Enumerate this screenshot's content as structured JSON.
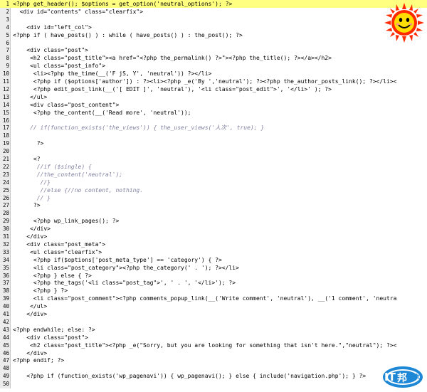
{
  "editor": {
    "lines": [
      {
        "n": "1",
        "t": "<?php get_header(); $options = get_option('neutral_options'); ?>",
        "current": true
      },
      {
        "n": "2",
        "t": "  <div id=\"contents\" class=\"clearfix\">"
      },
      {
        "n": "3",
        "t": ""
      },
      {
        "n": "4",
        "t": "    <div id=\"left_col\">"
      },
      {
        "n": "5",
        "t": "<?php if ( have_posts() ) : while ( have_posts() ) : the_post(); ?>"
      },
      {
        "n": "6",
        "t": ""
      },
      {
        "n": "7",
        "t": "    <div class=\"post\">"
      },
      {
        "n": "8",
        "t": "     <h2 class=\"post_title\"><a href=\"<?php the_permalink() ?>\"><?php the_title(); ?></a></h2>"
      },
      {
        "n": "9",
        "t": "     <ul class=\"post_info\">"
      },
      {
        "n": "10",
        "t": "      <li><?php the_time(__('F jS, Y', 'neutral')) ?></li>"
      },
      {
        "n": "11",
        "t": "      <?php if ($options['author']) : ?><li><?php _e('By ','neutral'); ?><?php the_author_posts_link(); ?></li><"
      },
      {
        "n": "12",
        "t": "      <?php edit_post_link(__('[ EDIT ]', 'neutral'), '<li class=\"post_edit\">', '</li>' ); ?>"
      },
      {
        "n": "13",
        "t": "     </ul>"
      },
      {
        "n": "14",
        "t": "     <div class=\"post_content\">"
      },
      {
        "n": "15",
        "t": "      <?php the_content(__('Read more', 'neutral'));"
      },
      {
        "n": "16",
        "t": ""
      },
      {
        "n": "17",
        "t": "     // if(function_exists('the_views')) { the_user_views('人次', true); }"
      },
      {
        "n": "18",
        "t": ""
      },
      {
        "n": "19",
        "t": "       ?>"
      },
      {
        "n": "20",
        "t": ""
      },
      {
        "n": "21",
        "t": "      <?"
      },
      {
        "n": "22",
        "t": "       //if ($single) {"
      },
      {
        "n": "23",
        "t": "       //the_content('neutral');"
      },
      {
        "n": "24",
        "t": "        //}"
      },
      {
        "n": "25",
        "t": "        //else {//no content, nothing."
      },
      {
        "n": "26",
        "t": "       // }"
      },
      {
        "n": "27",
        "t": "      ?>"
      },
      {
        "n": "28",
        "t": ""
      },
      {
        "n": "29",
        "t": "      <?php wp_link_pages(); ?>"
      },
      {
        "n": "30",
        "t": "     </div>"
      },
      {
        "n": "31",
        "t": "    </div>"
      },
      {
        "n": "32",
        "t": "    <div class=\"post_meta\">"
      },
      {
        "n": "33",
        "t": "     <ul class=\"clearfix\">"
      },
      {
        "n": "34",
        "t": "      <?php if($options['post_meta_type'] == 'category') { ?>"
      },
      {
        "n": "35",
        "t": "      <li class=\"post_category\"><?php the_category(' . '); ?></li>"
      },
      {
        "n": "36",
        "t": "      <?php } else { ?>"
      },
      {
        "n": "37",
        "t": "      <?php the_tags('<li class=\"post_tag\">', ' . ', '</li>'); ?>"
      },
      {
        "n": "38",
        "t": "      <?php } ?>"
      },
      {
        "n": "39",
        "t": "      <li class=\"post_comment\"><?php comments_popup_link(__('Write comment', 'neutral'), __('1 comment', 'neutra"
      },
      {
        "n": "40",
        "t": "     </ul>"
      },
      {
        "n": "41",
        "t": "    </div>"
      },
      {
        "n": "42",
        "t": ""
      },
      {
        "n": "43",
        "t": "<?php endwhile; else: ?>"
      },
      {
        "n": "44",
        "t": "    <div class=\"post\">"
      },
      {
        "n": "45",
        "t": "     <h2 class=\"post_title\"><?php _e(\"Sorry, but you are looking for something that isn't here.\",\"neutral\"); ?><"
      },
      {
        "n": "46",
        "t": "    </div>"
      },
      {
        "n": "47",
        "t": "<?php endif; ?>"
      },
      {
        "n": "48",
        "t": ""
      },
      {
        "n": "49",
        "t": "    <?php if (function_exists('wp_pagenavi')) { wp_pagenavi(); } else { include('navigation.php'); } ?>"
      },
      {
        "n": "50",
        "t": ""
      }
    ]
  },
  "logo": {
    "main": "IT",
    "accent": "邦",
    "sub": "幫忙"
  },
  "colors": {
    "current_line": "#ffff80",
    "gutter": "#ececec",
    "logo_blue": "#1e88d6",
    "sun": "#ff2a00",
    "face": "#ffdd00"
  }
}
